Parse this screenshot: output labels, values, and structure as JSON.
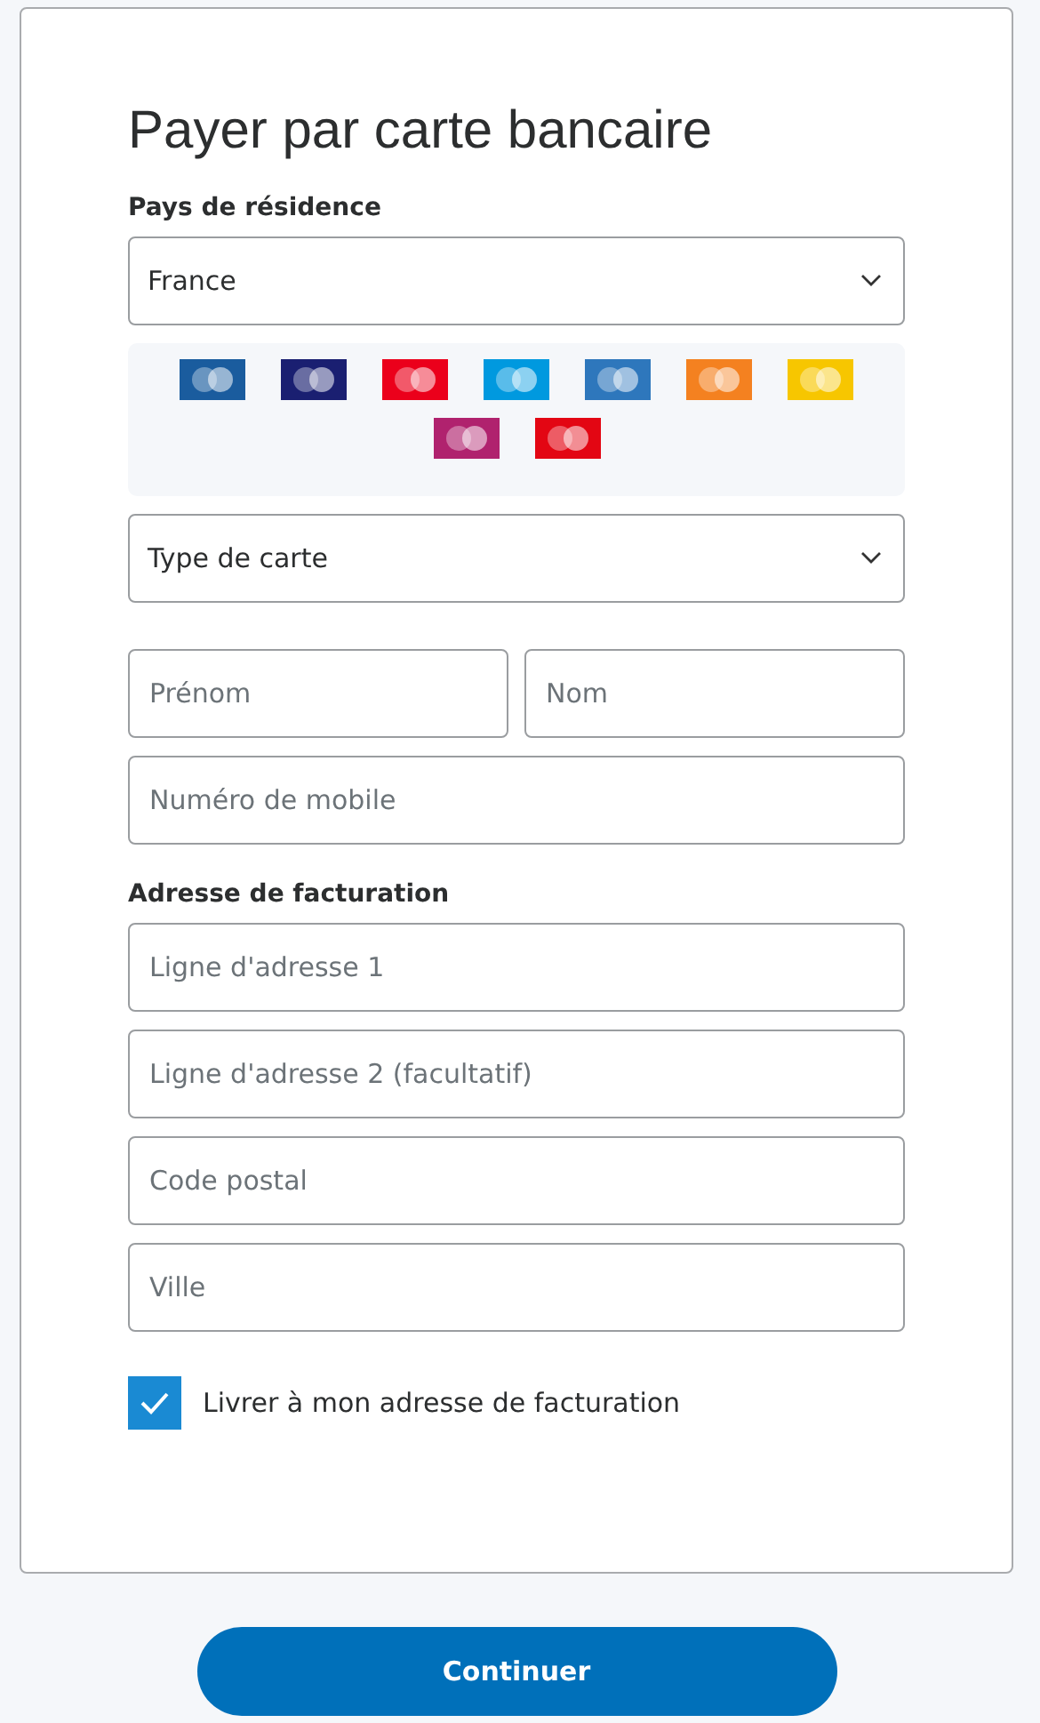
{
  "title": "Payer par carte bancaire",
  "country": {
    "label": "Pays de résidence",
    "value": "France"
  },
  "card_logos": [
    {
      "color": "#1a5c9e"
    },
    {
      "color": "#1a1f71"
    },
    {
      "color": "#eb001b"
    },
    {
      "color": "#0099df"
    },
    {
      "color": "#2e77bc"
    },
    {
      "color": "#f48120"
    },
    {
      "color": "#f7c600"
    },
    {
      "color": "#b0226e"
    },
    {
      "color": "#e30613"
    }
  ],
  "card_type": {
    "placeholder": "Type de carte"
  },
  "name_fields": [
    {
      "placeholder": "Prénom"
    },
    {
      "placeholder": "Nom"
    }
  ],
  "mobile": {
    "placeholder": "Numéro de mobile"
  },
  "billing": {
    "label": "Adresse de facturation",
    "fields": [
      {
        "placeholder": "Ligne d'adresse 1"
      },
      {
        "placeholder": "Ligne d'adresse 2 (facultatif)"
      },
      {
        "placeholder": "Code postal"
      },
      {
        "placeholder": "Ville"
      }
    ]
  },
  "ship_same": {
    "label": "Livrer à mon adresse de facturation",
    "checked": true
  },
  "continue_button": "Continuer"
}
